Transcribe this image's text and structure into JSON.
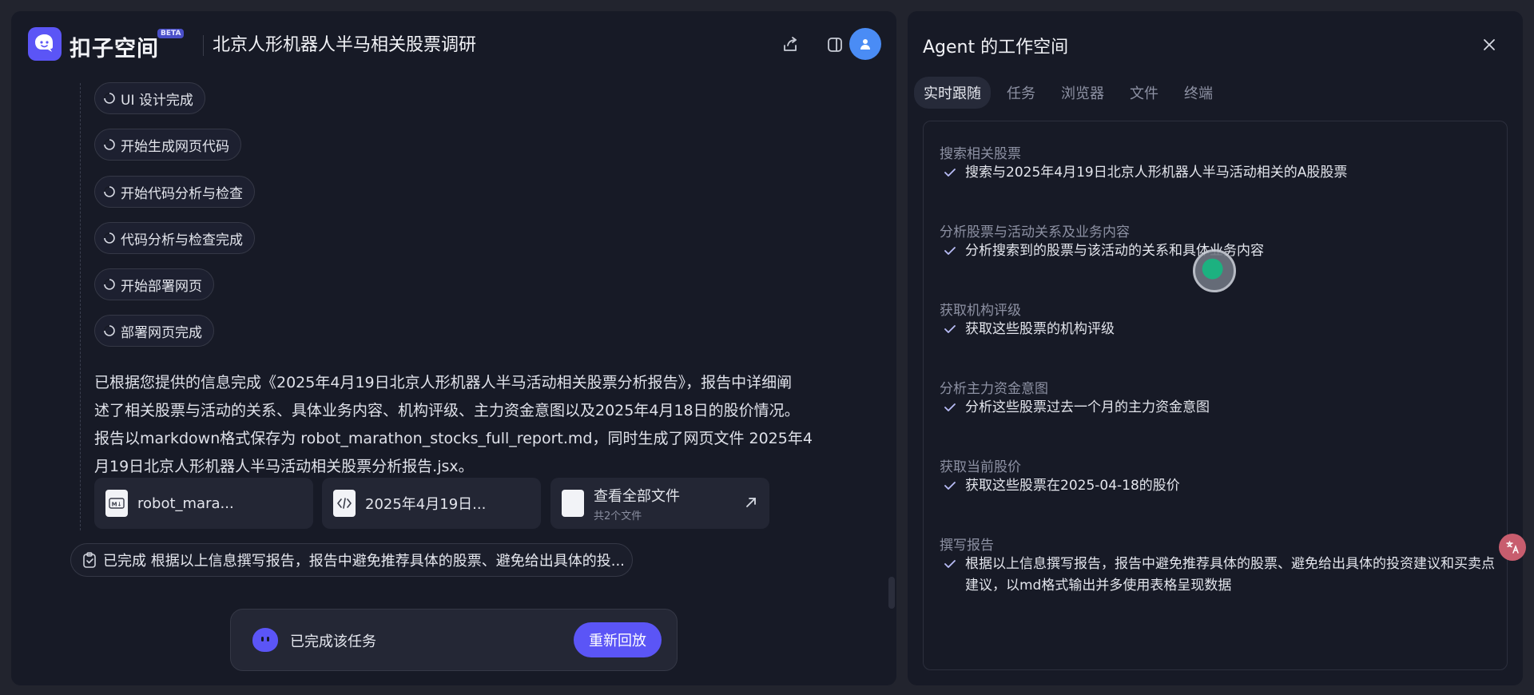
{
  "app": {
    "logo_text": "扣子空间",
    "beta_badge": "BETA"
  },
  "header": {
    "title": "北京人形机器人半马相关股票调研"
  },
  "steps": [
    {
      "label": "UI 设计完成"
    },
    {
      "label": "开始生成网页代码"
    },
    {
      "label": "开始代码分析与检查"
    },
    {
      "label": "代码分析与检查完成"
    },
    {
      "label": "开始部署网页"
    },
    {
      "label": "部署网页完成"
    }
  ],
  "summary": {
    "text": "已根据您提供的信息完成《2025年4月19日北京人形机器人半马活动相关股票分析报告》，报告中详细阐\n述了相关股票与活动的关系、具体业务内容、机构评级、主力资金意图以及2025年4月18日的股价情况。\n报告以markdown格式保存为 robot_marathon_stocks_full_report.md，同时生成了网页文件 2025年4\n月19日北京人形机器人半马活动相关股票分析报告.jsx。"
  },
  "files": [
    {
      "name": "robot_mara...",
      "icon": "markdown-file-icon"
    },
    {
      "name": "2025年4月19日...",
      "icon": "code-file-icon"
    },
    {
      "name": "查看全部文件",
      "sub": "共2个文件",
      "icon": "file-icon"
    }
  ],
  "completed_pill": {
    "text": "已完成 根据以上信息撰写报告，报告中避免推荐具体的股票、避免给出具体的投..."
  },
  "bottom_bar": {
    "status": "已完成该任务",
    "replay_label": "重新回放"
  },
  "right_panel": {
    "title": "Agent 的工作空间",
    "tabs": [
      "实时跟随",
      "任务",
      "浏览器",
      "文件",
      "终端"
    ],
    "active_tab": "实时跟随",
    "sections": [
      {
        "title": "搜索相关股票",
        "item": "搜索与2025年4月19日北京人形机器人半马活动相关的A股股票"
      },
      {
        "title": "分析股票与活动关系及业务内容",
        "item": "分析搜索到的股票与该活动的关系和具体业务内容"
      },
      {
        "title": "获取机构评级",
        "item": "获取这些股票的机构评级"
      },
      {
        "title": "分析主力资金意图",
        "item": "分析这些股票过去一个月的主力资金意图"
      },
      {
        "title": "获取当前股价",
        "item": "获取这些股票在2025-04-18的股价"
      },
      {
        "title": "撰写报告",
        "item": "根据以上信息撰写报告，报告中避免推荐具体的股票、避免给出具体的投资建议和买卖点建议，以md格式输出并多使用表格呈现数据"
      }
    ]
  },
  "colors": {
    "accent": "#5b55f6",
    "background": "#171a26",
    "avatar": "#4a8cf5"
  }
}
